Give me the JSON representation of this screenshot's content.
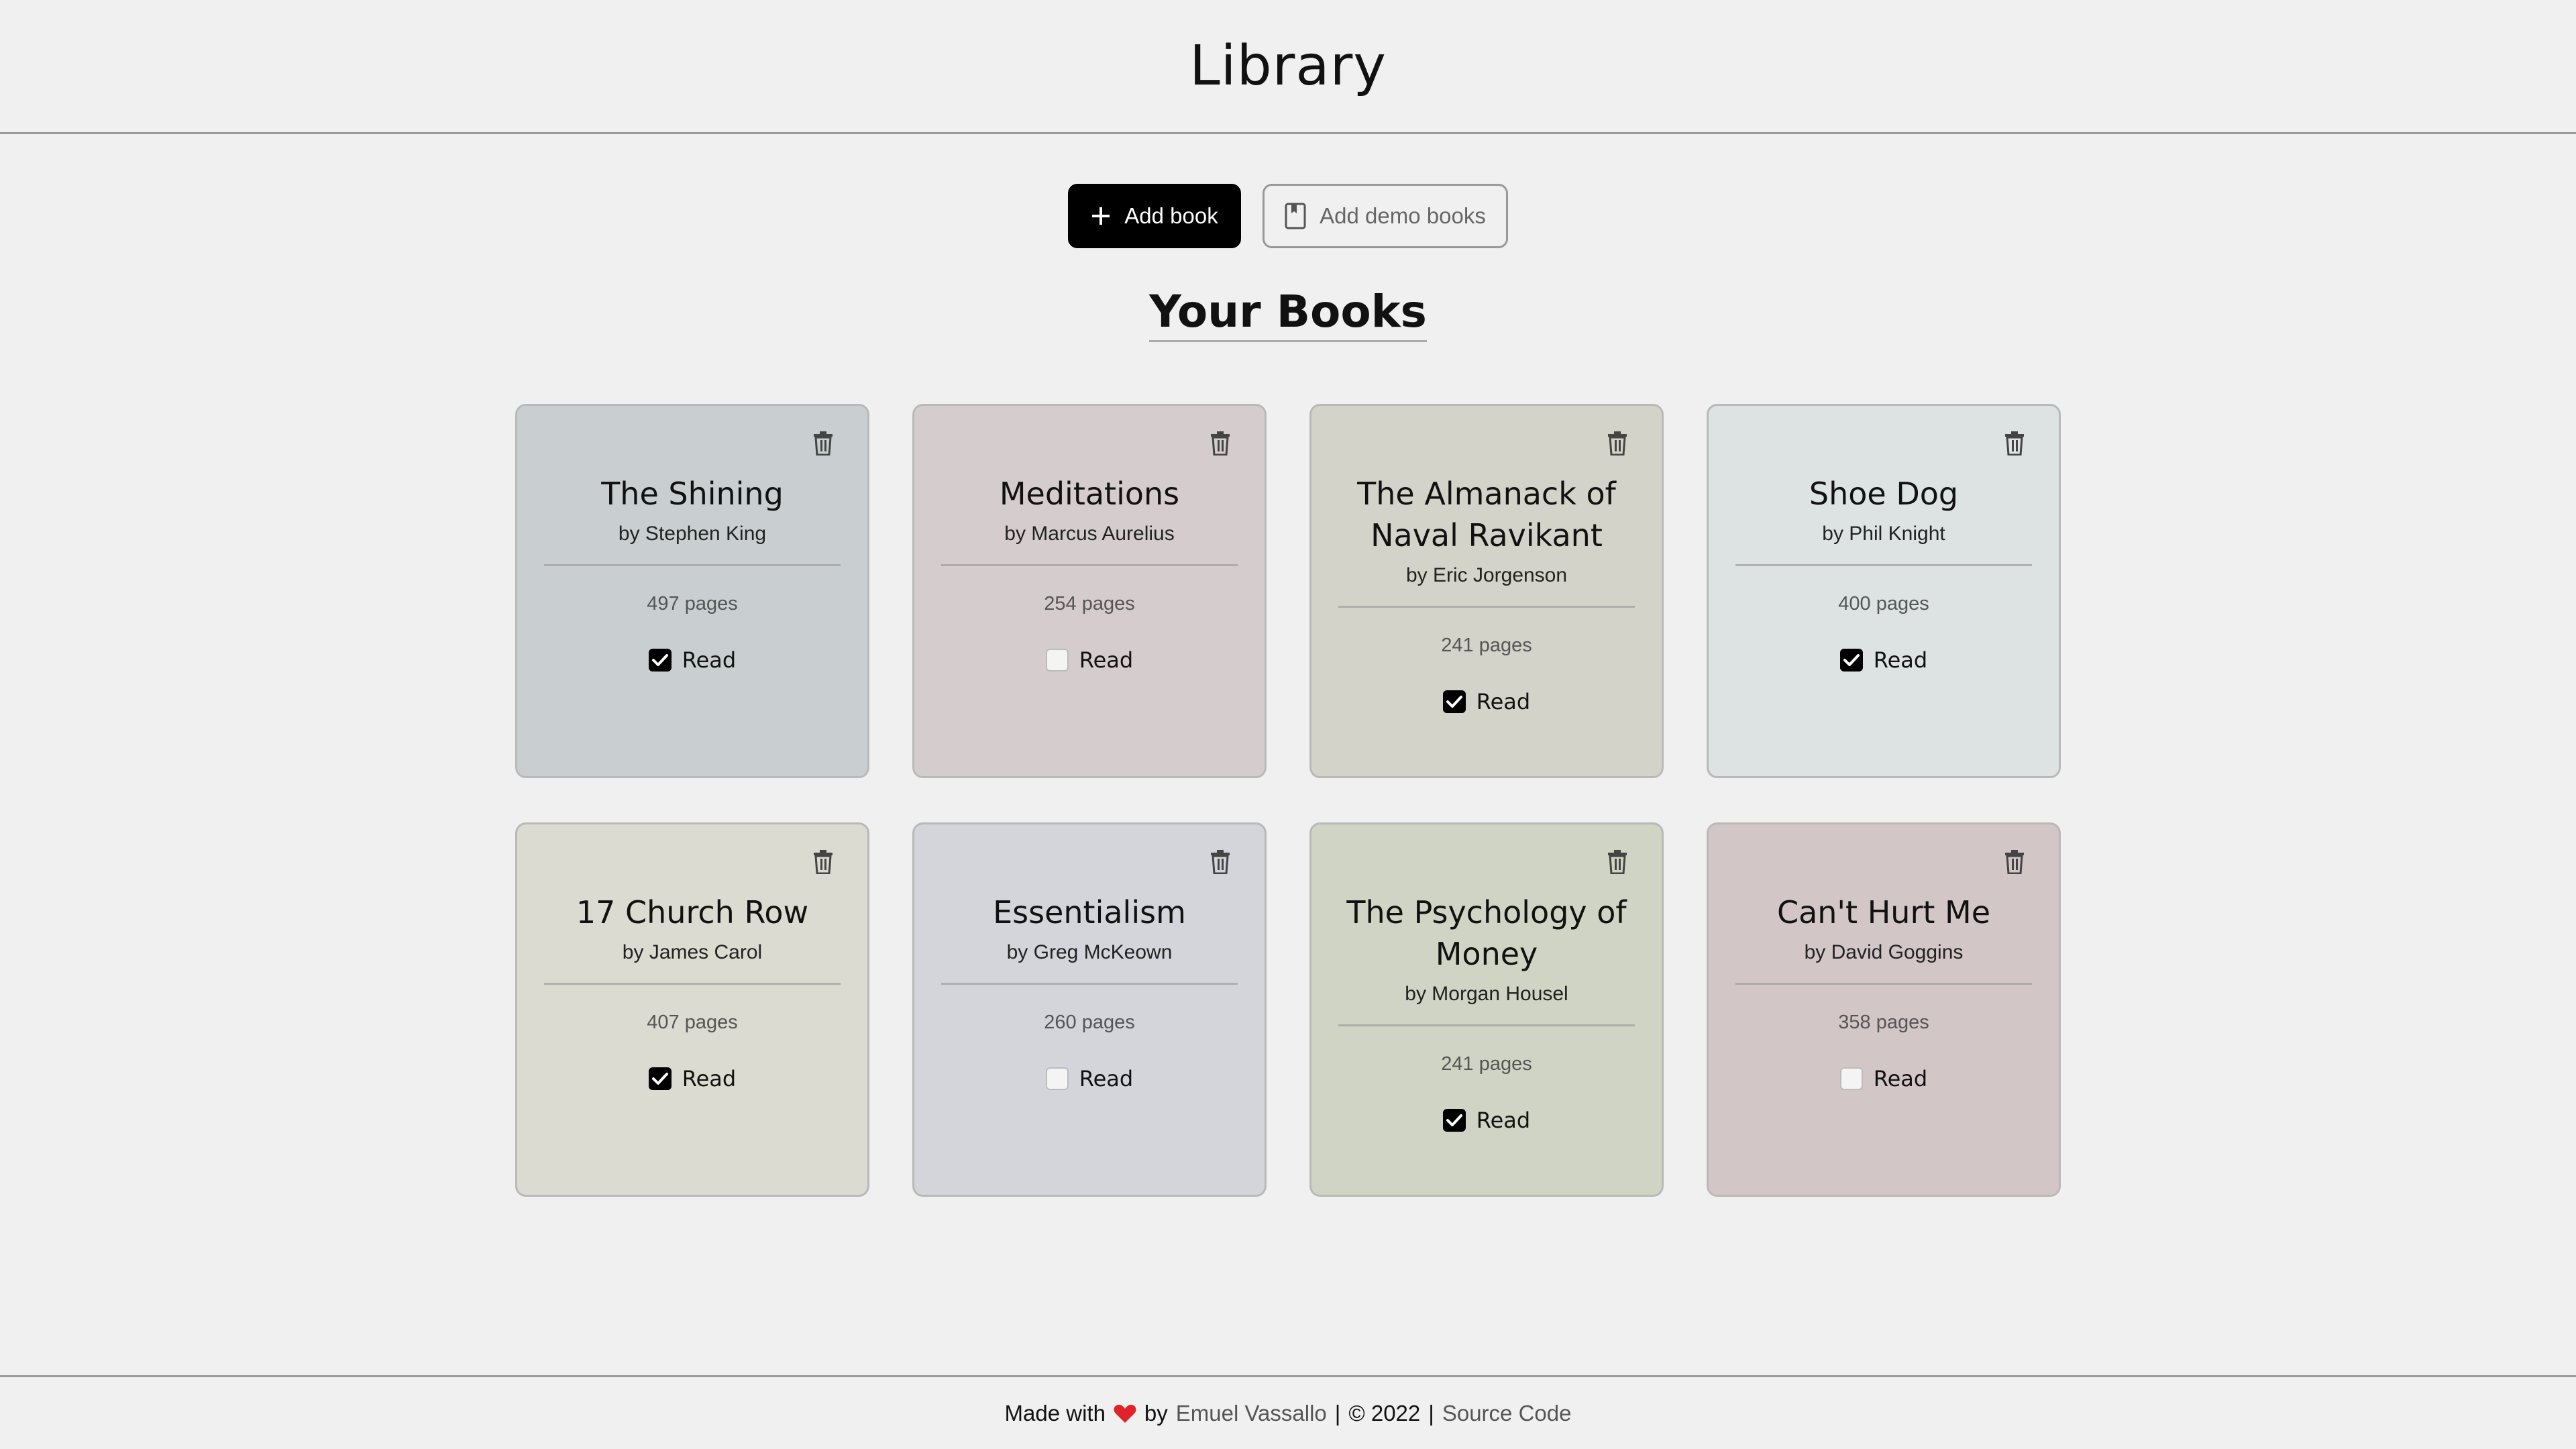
{
  "header": {
    "title": "Library"
  },
  "actions": {
    "add_book_label": "Add book",
    "add_book_icon": "plus-icon",
    "add_demo_label": "Add demo books",
    "add_demo_icon": "bookmark-icon"
  },
  "section": {
    "title": "Your Books"
  },
  "colors": {
    "primary_button": "#000000",
    "checkbox_checked": "#000000",
    "heart": "#e0232a"
  },
  "books": [
    {
      "title": "The Shining",
      "author": "by Stephen King",
      "pages": "497 pages",
      "read_label": "Read",
      "read": true,
      "color": "#c9ced1"
    },
    {
      "title": "Meditations",
      "author": "by Marcus Aurelius",
      "pages": "254 pages",
      "read_label": "Read",
      "read": false,
      "color": "#d5cdcd"
    },
    {
      "title": "The Almanack of Naval Ravikant",
      "author": "by Eric Jorgenson",
      "pages": "241 pages",
      "read_label": "Read",
      "read": true,
      "color": "#d4d3ca"
    },
    {
      "title": "Shoe Dog",
      "author": "by Phil Knight",
      "pages": "400 pages",
      "read_label": "Read",
      "read": true,
      "color": "#dde3e2"
    },
    {
      "title": "17 Church Row",
      "author": "by James Carol",
      "pages": "407 pages",
      "read_label": "Read",
      "read": true,
      "color": "#dbdbd2"
    },
    {
      "title": "Essentialism",
      "author": "by Greg McKeown",
      "pages": "260 pages",
      "read_label": "Read",
      "read": false,
      "color": "#d4d5da"
    },
    {
      "title": "The Psychology of Money",
      "author": "by Morgan Housel",
      "pages": "241 pages",
      "read_label": "Read",
      "read": true,
      "color": "#d0d4c4"
    },
    {
      "title": "Can't Hurt Me",
      "author": "by David Goggins",
      "pages": "358 pages",
      "read_label": "Read",
      "read": false,
      "color": "#d2c6c7"
    }
  ],
  "footer": {
    "made_with": "Made with",
    "heart_icon": "heart-icon",
    "by": "by",
    "author_link": "Emuel Vassallo",
    "separator_1": "|",
    "copyright": "© 2022",
    "separator_2": "|",
    "source_link": "Source Code"
  }
}
